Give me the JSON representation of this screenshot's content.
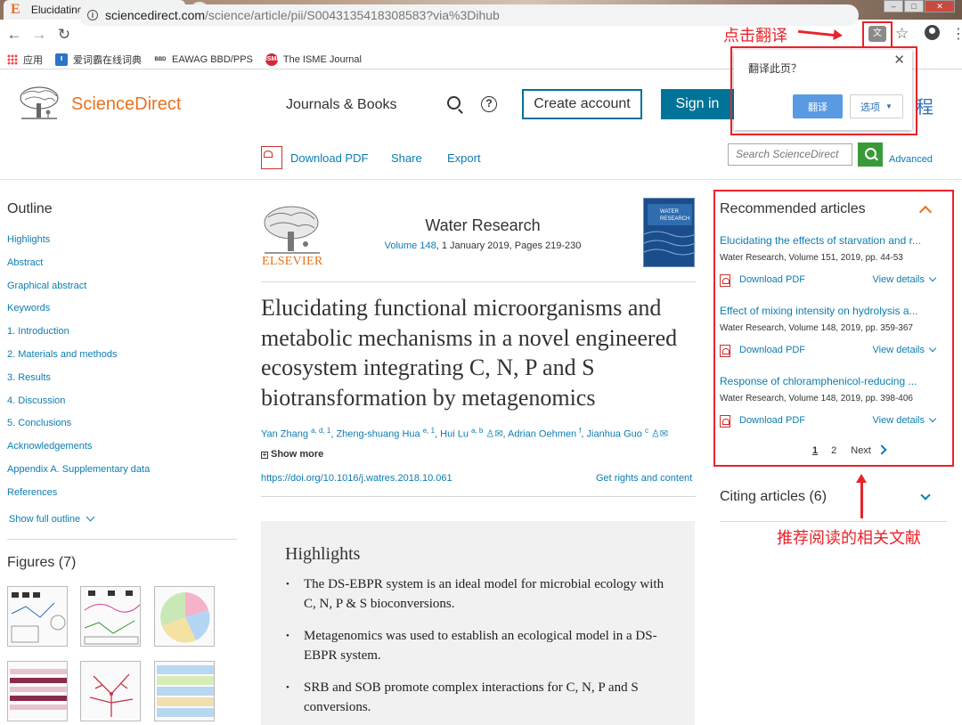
{
  "browser": {
    "tab_title": "Elucidating functional microor",
    "tab_favicon": "E",
    "url_host": "sciencedirect.com",
    "url_path": "/science/article/pii/S0043135418308583?via%3Dihub",
    "bookmarks": [
      {
        "label": "应用",
        "icon": "apps-icon"
      },
      {
        "label": "爱词霸在线词典",
        "icon": "iciba-icon"
      },
      {
        "label": "EAWAG BBD/PPS",
        "icon": "eawag-icon"
      },
      {
        "label": "The ISME Journal",
        "icon": "isme-icon"
      }
    ],
    "translate_annotation": "点击翻译",
    "translate_popup": {
      "question": "翻译此页？",
      "translate_label": "翻译",
      "options_label": "选项"
    }
  },
  "header": {
    "brand": "ScienceDirect",
    "journals_books": "Journals & Books",
    "create_account": "Create account",
    "sign_in": "Sign in",
    "institution_glyph": "程"
  },
  "article_toolbar": {
    "download_pdf": "Download PDF",
    "share": "Share",
    "export": "Export",
    "search_placeholder": "Search ScienceDirect",
    "advanced": "Advanced"
  },
  "outline": {
    "title": "Outline",
    "items": [
      "Highlights",
      "Abstract",
      "Graphical abstract",
      "Keywords",
      "1. Introduction",
      "2. Materials and methods",
      "3. Results",
      "4. Discussion",
      "5. Conclusions",
      "Acknowledgements",
      "Appendix A. Supplementary data",
      "References"
    ],
    "show_full": "Show full outline",
    "figures_title": "Figures (7)"
  },
  "article": {
    "publisher": "ELSEVIER",
    "journal": "Water Research",
    "volume_link": "Volume 148",
    "volume_rest": ", 1 January 2019, Pages 219-230",
    "title": "Elucidating functional microorganisms and metabolic mechanisms in a novel engineered ecosystem integrating C, N, P and S biotransformation by metagenomics",
    "authors": [
      {
        "name": "Yan Zhang",
        "sup": "a, d, 1"
      },
      {
        "name": "Zheng-shuang Hua",
        "sup": "e, 1"
      },
      {
        "name": "Hui Lu",
        "sup": "a, b"
      },
      {
        "name": "Adrian Oehmen",
        "sup": "f"
      },
      {
        "name": "Jianhua Guo",
        "sup": "c"
      }
    ],
    "show_more": "Show more",
    "doi": "https://doi.org/10.1016/j.watres.2018.10.061",
    "rights": "Get rights and content",
    "highlights_title": "Highlights",
    "highlights": [
      "The DS-EBPR system is an ideal model for microbial ecology with C, N, P & S bioconversions.",
      "Metagenomics was used to establish an ecological model in a DS-EBPR system.",
      "SRB and SOB promote complex interactions for C, N, P and S conversions."
    ]
  },
  "recommended": {
    "title": "Recommended articles",
    "items": [
      {
        "title": "Elucidating the effects of starvation and r...",
        "meta": "Water Research, Volume 151, 2019, pp. 44-53"
      },
      {
        "title": "Effect of mixing intensity on hydrolysis a...",
        "meta": "Water Research, Volume 148, 2019, pp. 359-367"
      },
      {
        "title": "Response of chloramphenicol-reducing ...",
        "meta": "Water Research, Volume 148, 2019, pp. 398-406"
      }
    ],
    "download_pdf": "Download PDF",
    "view_details": "View details",
    "page1": "1",
    "page2": "2",
    "next": "Next",
    "citing": "Citing articles (6)",
    "annotation": "推荐阅读的相关文献"
  }
}
